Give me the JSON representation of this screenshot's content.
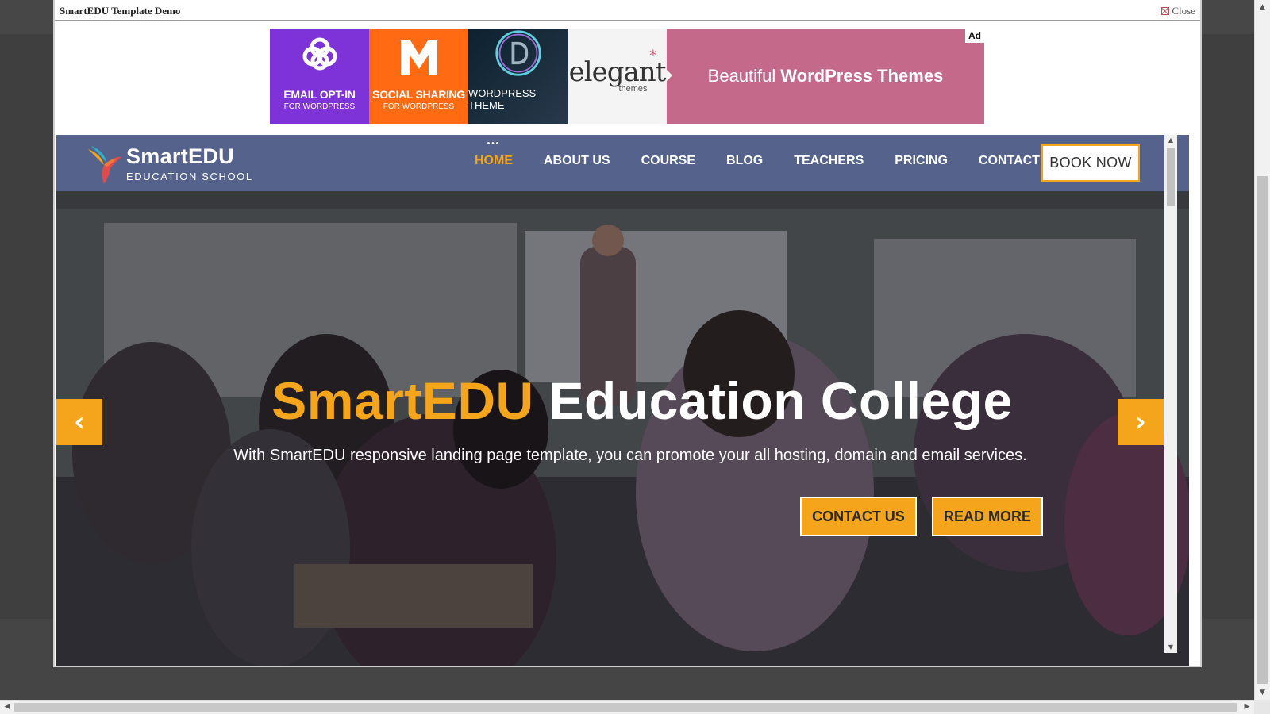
{
  "modal": {
    "title": "SmartEDU Template Demo",
    "close_label": "Close"
  },
  "ad": {
    "badge": "Ad",
    "tiles": [
      {
        "title": "EMAIL OPT-IN",
        "subtitle": "FOR WORDPRESS",
        "color": "#7d33d8"
      },
      {
        "title": "SOCIAL SHARING",
        "subtitle": "FOR WORDPRESS",
        "color": "#ff6a12"
      },
      {
        "title": "WORDPRESS THEME",
        "subtitle": "",
        "color": "#0d2130"
      },
      {
        "title": "elegant",
        "subtitle": "themes",
        "color": "#f4f4f4"
      }
    ],
    "tagline_plain": "Beautiful",
    "tagline_bold": "WordPress Themes",
    "tagline_color": "#c5698a"
  },
  "site": {
    "brand": {
      "name": "SmartEDU",
      "tagline": "EDUCATION SCHOOL"
    },
    "nav": [
      {
        "label": "HOME",
        "active": true
      },
      {
        "label": "ABOUT US",
        "active": false
      },
      {
        "label": "COURSE",
        "active": false
      },
      {
        "label": "BLOG",
        "active": false
      },
      {
        "label": "TEACHERS",
        "active": false
      },
      {
        "label": "PRICING",
        "active": false
      },
      {
        "label": "CONTACT",
        "active": false
      }
    ],
    "nav_dots": "•••",
    "book_now": "BOOK NOW",
    "hero": {
      "title_accent": "SmartEDU",
      "title_rest": "Education College",
      "subtitle": "With SmartEDU responsive landing page template, you can promote your all hosting, domain and email services.",
      "btn_contact": "CONTACT US",
      "btn_read_more": "READ MORE",
      "prev_icon": "‹",
      "next_icon": "›"
    },
    "colors": {
      "navbar": "#55628b",
      "accent": "#f4a51c"
    }
  },
  "scrollbars": {
    "up": "▲",
    "down": "▼",
    "left": "◀",
    "right": "▶"
  }
}
